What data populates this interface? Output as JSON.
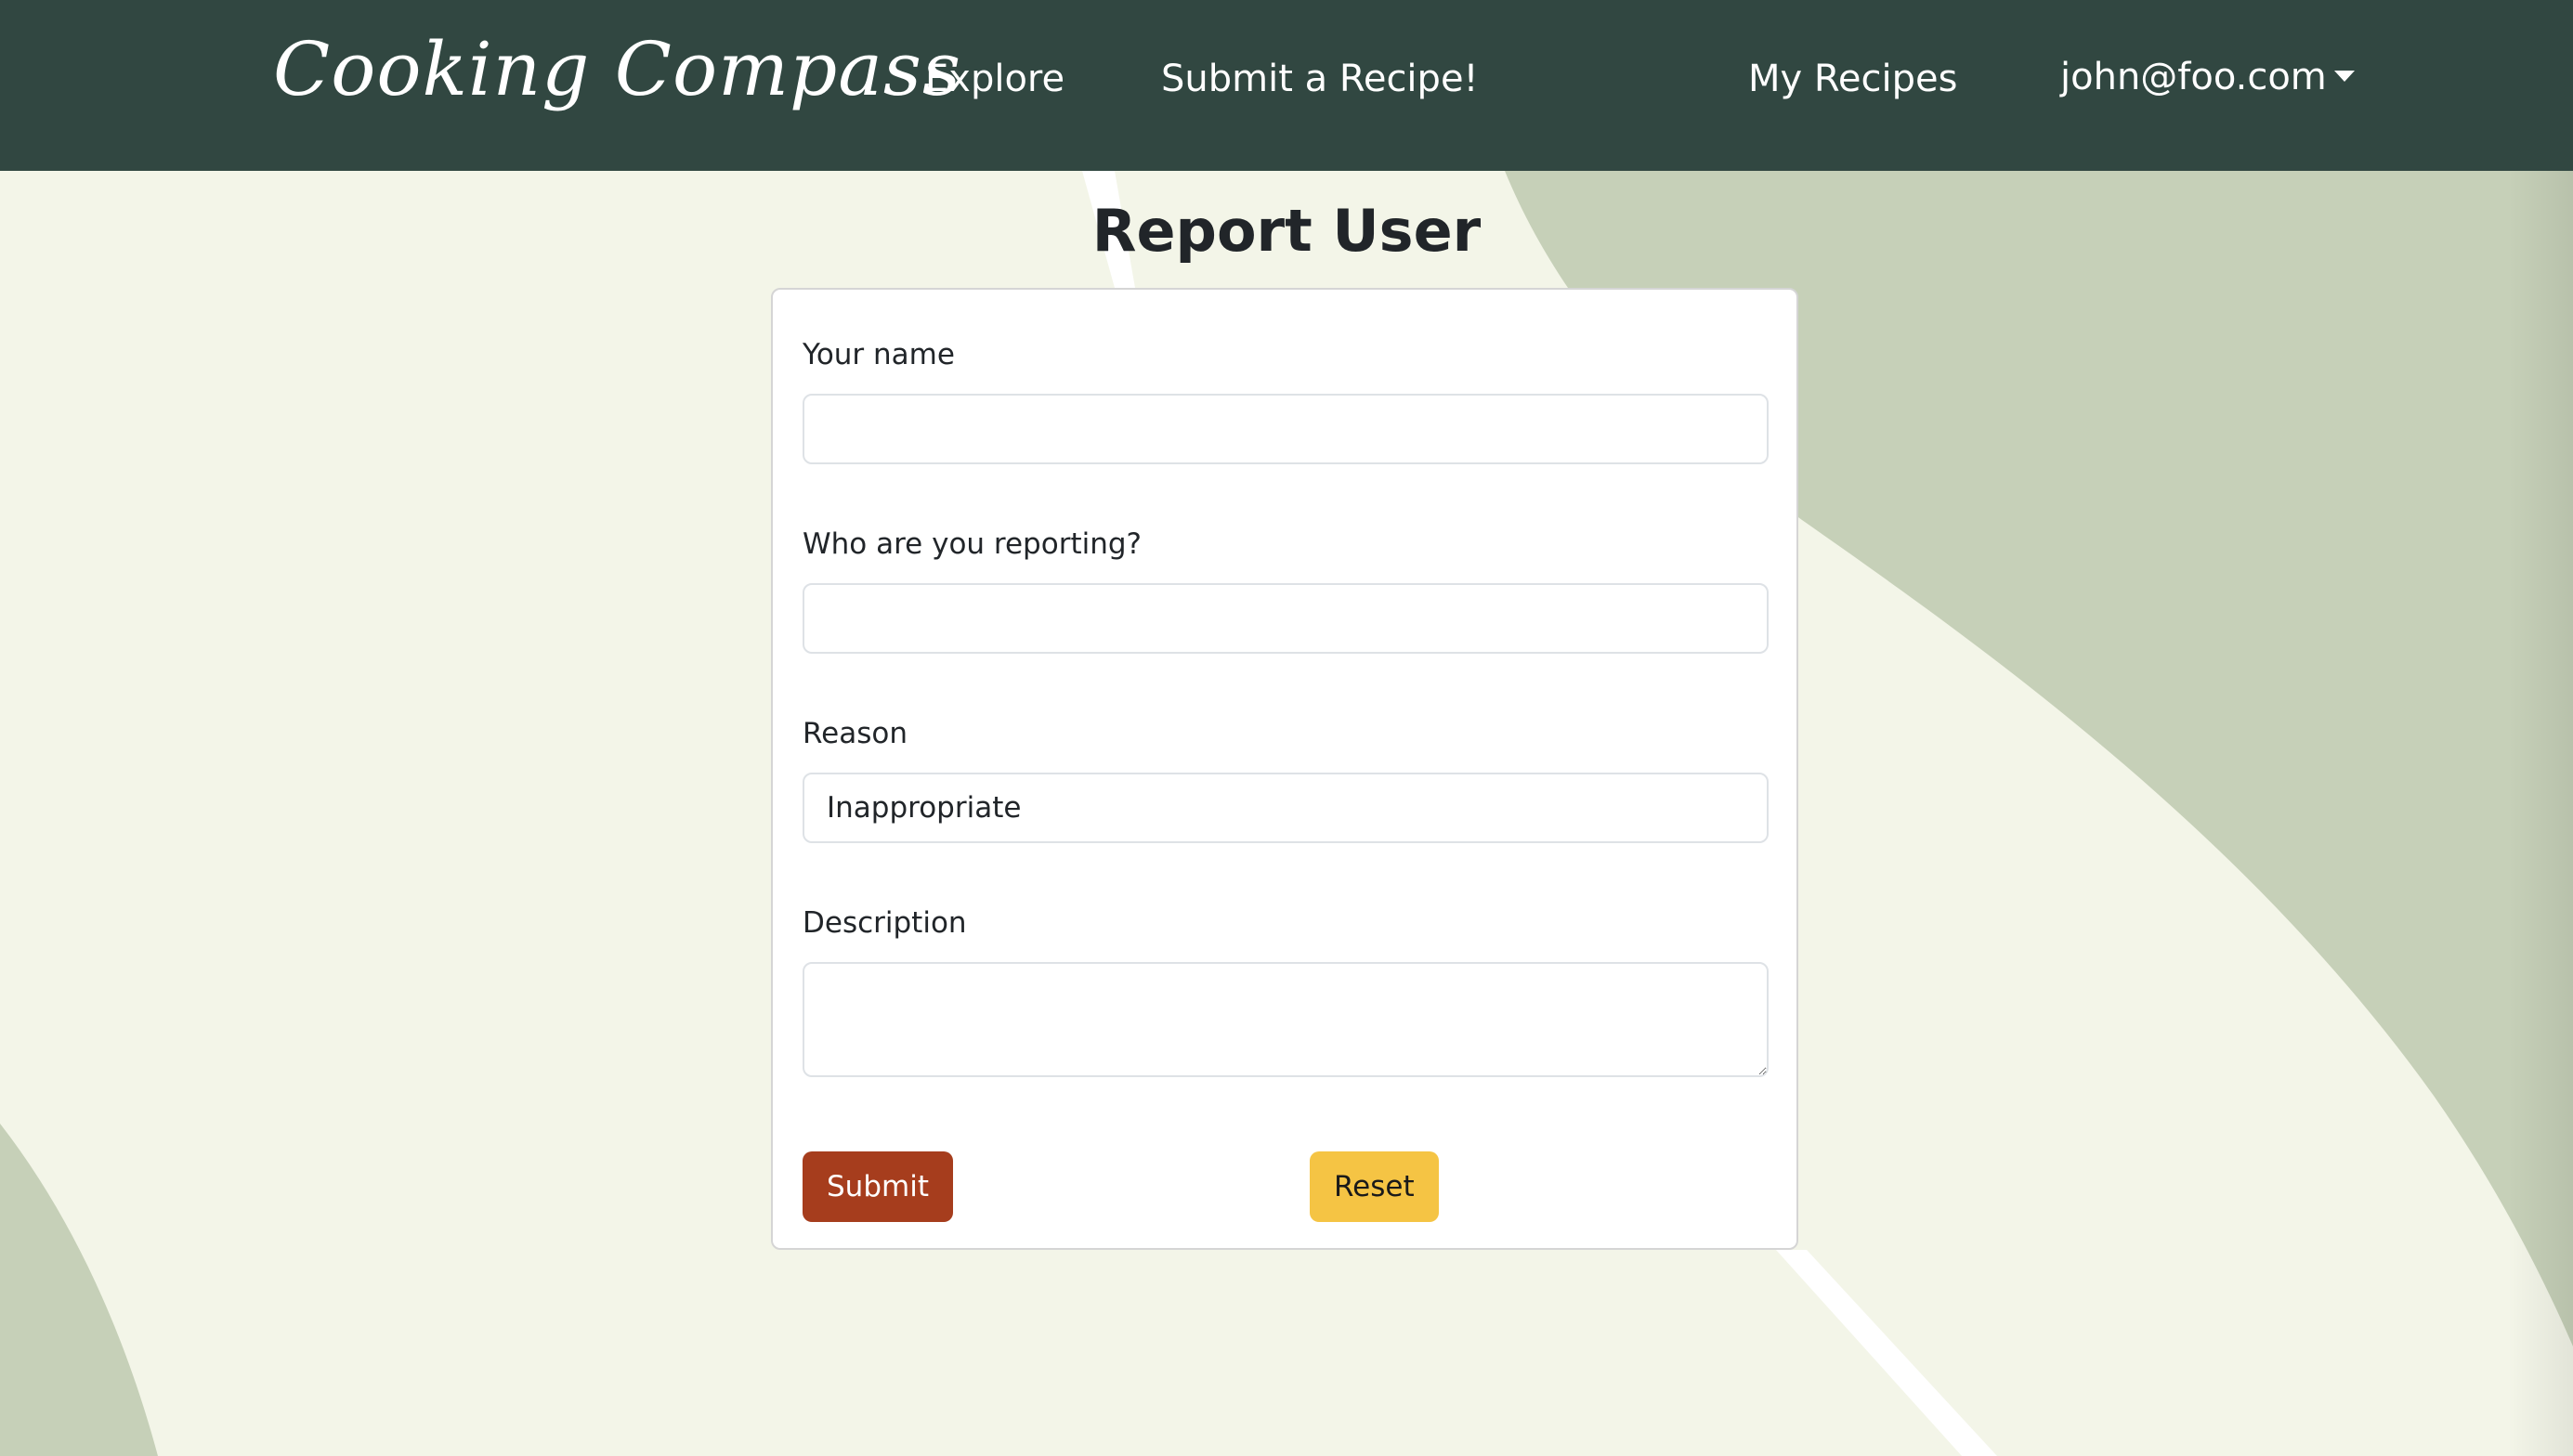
{
  "navbar": {
    "brand": "Cooking Compass",
    "links": {
      "explore": "Explore",
      "submit_recipe": "Submit a Recipe!",
      "my_recipes": "My Recipes"
    },
    "user_email": "john@foo.com"
  },
  "page": {
    "title": "Report User"
  },
  "form": {
    "name_label": "Your name",
    "name_value": "",
    "reported_label": "Who are you reporting?",
    "reported_value": "",
    "reason_label": "Reason",
    "reason_selected": "Inappropriate",
    "description_label": "Description",
    "description_value": "",
    "submit_label": "Submit",
    "reset_label": "Reset"
  },
  "colors": {
    "navbar": "#314741",
    "background": "#f3f5e8",
    "shape": "#c6d0b8",
    "submit": "#a63d1d",
    "reset": "#f5c444"
  }
}
